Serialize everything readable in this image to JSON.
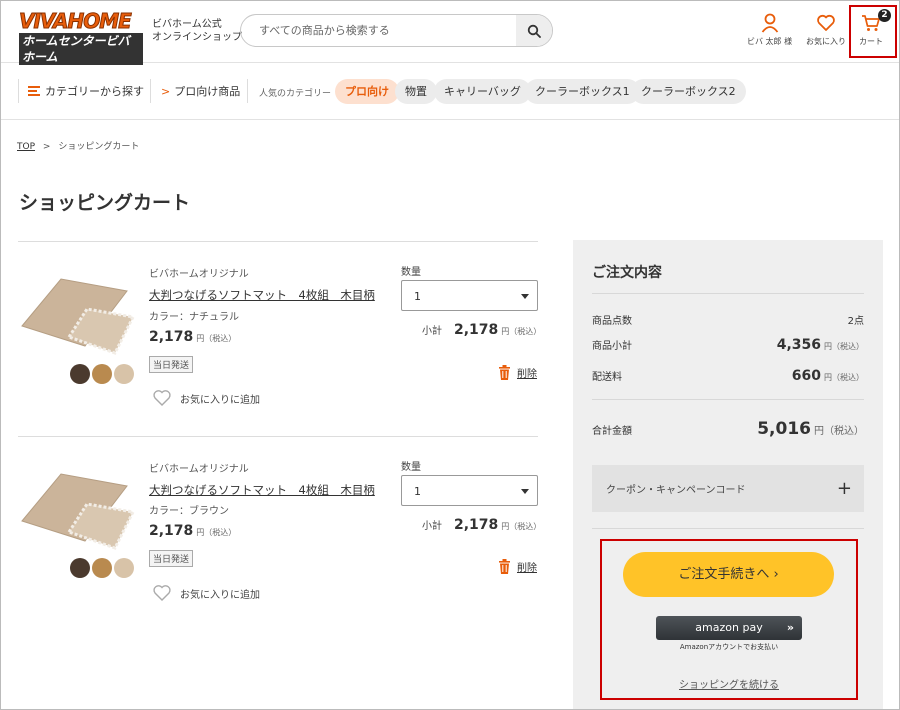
{
  "header": {
    "logo_top": "VIVAHOME",
    "logo_bottom": "ホームセンタービバホーム",
    "shop_sub_line1": "ビバホーム公式",
    "shop_sub_line2": "オンラインショップ",
    "search_placeholder": "すべての商品から検索する",
    "user_label": "ビバ 太郎 様",
    "favorites_label": "お気に入り",
    "cart_label": "カート",
    "cart_count": "2"
  },
  "catbar": {
    "category_button": "カテゴリーから探す",
    "pro_button": "プロ向け商品",
    "popular_label": "人気のカテゴリー",
    "chips": [
      "プロ向け",
      "物置",
      "キャリーバッグ",
      "クーラーボックス1",
      "クーラーボックス2"
    ]
  },
  "breadcrumb": {
    "top": "TOP",
    "separator": ">",
    "current": "ショッピングカート"
  },
  "page_title": "ショッピングカート",
  "cart_items": [
    {
      "brand": "ビバホームオリジナル",
      "name": "大判つなげるソフトマット　4枚組　木目柄",
      "color": "カラー：ナチュラル",
      "price": "2,178",
      "price_unit": "円（税込）",
      "tag": "当日発送",
      "favorite_label": "お気に入りに追加",
      "qty_label": "数量",
      "qty_value": "1",
      "subtotal_label": "小計",
      "subtotal": "2,178",
      "subtotal_unit": "円（税込）",
      "delete_label": "削除"
    },
    {
      "brand": "ビバホームオリジナル",
      "name": "大判つなげるソフトマット　4枚組　木目柄",
      "color": "カラー：ブラウン",
      "price": "2,178",
      "price_unit": "円（税込）",
      "tag": "当日発送",
      "favorite_label": "お気に入りに追加",
      "qty_label": "数量",
      "qty_value": "1",
      "subtotal_label": "小計",
      "subtotal": "2,178",
      "subtotal_unit": "円（税込）",
      "delete_label": "削除"
    }
  ],
  "summary": {
    "title": "ご注文内容",
    "item_count_label": "商品点数",
    "item_count": "2点",
    "subtotal_label": "商品小計",
    "subtotal": "4,356",
    "shipping_label": "配送料",
    "shipping": "660",
    "yen_tax": "円（税込）",
    "total_label": "合計金額",
    "total": "5,016",
    "coupon_label": "クーポン・キャンペーンコード",
    "coupon_plus": "+",
    "order_button": "ご注文手続きへ ›",
    "amazon_pay": "amazon pay",
    "amazon_chevron": "»",
    "amazon_note": "Amazonアカウントでお支払い",
    "continue_shopping": "ショッピングを続ける"
  },
  "colors": {
    "accent": "#e85d0b",
    "order_button": "#ffc328",
    "highlight_box": "#cc0000"
  }
}
